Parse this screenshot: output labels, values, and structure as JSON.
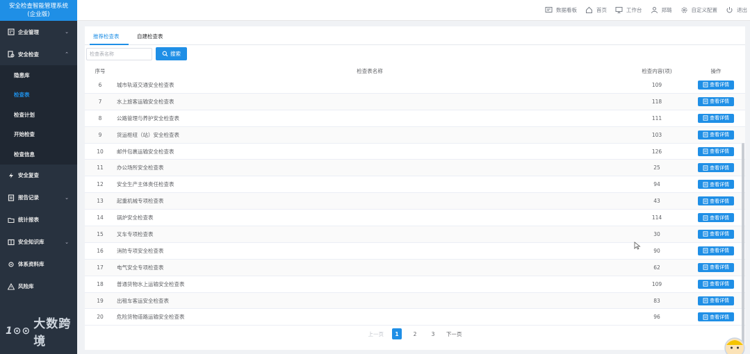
{
  "app": {
    "title_line1": "安全检查智能管理系统",
    "title_line2": "(企业版)"
  },
  "sidebar": {
    "menu": [
      {
        "label": "企业管理",
        "icon": "building-icon",
        "has_arrow": true,
        "arrow": "⌄"
      },
      {
        "label": "安全检查",
        "icon": "inspect-icon",
        "has_arrow": true,
        "arrow": "⌃"
      }
    ],
    "submenu": [
      {
        "label": "隐患库",
        "active": false
      },
      {
        "label": "检查表",
        "active": true
      },
      {
        "label": "检查计划",
        "active": false
      },
      {
        "label": "开始检查",
        "active": false
      },
      {
        "label": "检查信息",
        "active": false
      }
    ],
    "menu2": [
      {
        "label": "安全复查",
        "icon": "review-icon",
        "has_arrow": false
      },
      {
        "label": "报告记录",
        "icon": "report-icon",
        "has_arrow": true,
        "arrow": "⌄"
      },
      {
        "label": "统计报表",
        "icon": "folder-icon",
        "has_arrow": false
      },
      {
        "label": "安全知识库",
        "icon": "book-icon",
        "has_arrow": true,
        "arrow": "⌄"
      },
      {
        "label": "体系资料库",
        "icon": "system-icon",
        "has_arrow": false
      },
      {
        "label": "风险库",
        "icon": "warning-icon",
        "has_arrow": false
      }
    ],
    "watermark": "大数跨境",
    "watermark_logo": "1⊙⊙"
  },
  "header": {
    "buttons": [
      {
        "label": "数据看板",
        "icon": "dashboard-icon"
      },
      {
        "label": "首页",
        "icon": "home-icon"
      },
      {
        "label": "工作台",
        "icon": "monitor-icon"
      },
      {
        "label": "郑璐",
        "icon": "user-icon"
      },
      {
        "label": "自定义配置",
        "icon": "gear-icon"
      },
      {
        "label": "退出",
        "icon": "power-icon"
      }
    ]
  },
  "tabs": [
    {
      "label": "推荐检查表",
      "active": true
    },
    {
      "label": "自建检查表",
      "active": false
    }
  ],
  "search": {
    "placeholder": "检查表名称",
    "value": "",
    "button_label": "搜索"
  },
  "table": {
    "headers": {
      "no": "序号",
      "name": "检查表名称",
      "count": "检查内容(项)",
      "op": "操作"
    },
    "detail_label": "查看详情",
    "rows": [
      {
        "no": "6",
        "name": "城市轨道交通安全检查表",
        "count": "109"
      },
      {
        "no": "7",
        "name": "水上旅客运输安全检查表",
        "count": "118"
      },
      {
        "no": "8",
        "name": "公路管理与养护安全检查表",
        "count": "111"
      },
      {
        "no": "9",
        "name": "货运枢纽（站）安全检查表",
        "count": "103"
      },
      {
        "no": "10",
        "name": "邮件包裹运输安全检查表",
        "count": "126"
      },
      {
        "no": "11",
        "name": "办公场所安全检查表",
        "count": "25"
      },
      {
        "no": "12",
        "name": "安全生产主体责任检查表",
        "count": "94"
      },
      {
        "no": "13",
        "name": "起重机械专项检查表",
        "count": "43"
      },
      {
        "no": "14",
        "name": "锅炉安全检查表",
        "count": "114"
      },
      {
        "no": "15",
        "name": "叉车专项检查表",
        "count": "30"
      },
      {
        "no": "16",
        "name": "消防专项安全检查表",
        "count": "90"
      },
      {
        "no": "17",
        "name": "电气安全专项检查表",
        "count": "62"
      },
      {
        "no": "18",
        "name": "普通货物水上运输安全检查表",
        "count": "109"
      },
      {
        "no": "19",
        "name": "出租车客运安全检查表",
        "count": "83"
      },
      {
        "no": "20",
        "name": "危险货物道路运输安全检查表",
        "count": "96"
      }
    ]
  },
  "pagination": {
    "prev": "上一页",
    "pages": [
      "1",
      "2",
      "3"
    ],
    "current": "1",
    "next": "下一页"
  },
  "colors": {
    "primary": "#1f8fe6",
    "sidebar": "#28323f",
    "sidebar_sub": "#1f2732"
  }
}
